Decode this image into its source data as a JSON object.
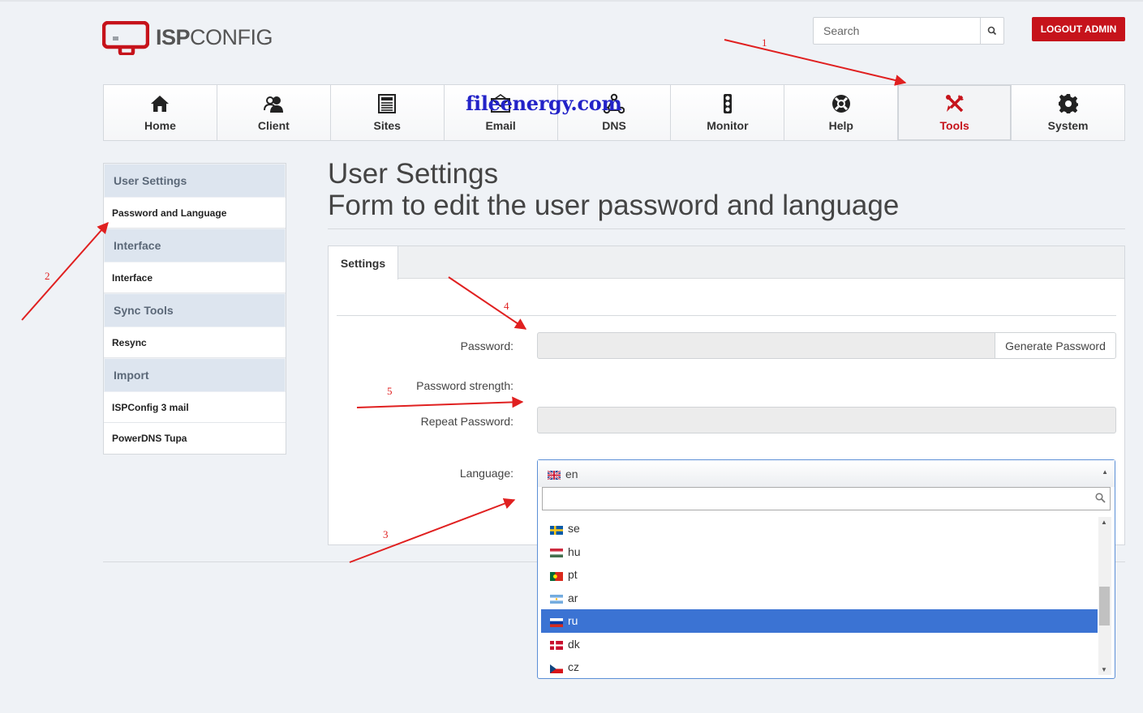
{
  "header": {
    "logo_text_bold": "ISP",
    "logo_text_light": "CONFIG",
    "search_placeholder": "Search",
    "logout_label": "LOGOUT ADMIN"
  },
  "nav": [
    {
      "label": "Home",
      "icon": "home-icon"
    },
    {
      "label": "Client",
      "icon": "users-icon"
    },
    {
      "label": "Sites",
      "icon": "sites-icon"
    },
    {
      "label": "Email",
      "icon": "envelope-icon"
    },
    {
      "label": "DNS",
      "icon": "dns-network-icon"
    },
    {
      "label": "Monitor",
      "icon": "traffic-light-icon"
    },
    {
      "label": "Help",
      "icon": "life-ring-icon"
    },
    {
      "label": "Tools",
      "icon": "tools-icon",
      "active": true
    },
    {
      "label": "System",
      "icon": "gear-icon"
    }
  ],
  "watermark": "fileenergy.com",
  "sidebar": {
    "sections": [
      {
        "title": "User Settings",
        "items": [
          "Password and Language"
        ]
      },
      {
        "title": "Interface",
        "items": [
          "Interface"
        ]
      },
      {
        "title": "Sync Tools",
        "items": [
          "Resync"
        ]
      },
      {
        "title": "Import",
        "items": [
          "ISPConfig 3 mail",
          "PowerDNS Tupa"
        ]
      }
    ]
  },
  "page": {
    "title_line1": "User Settings",
    "title_line2": "Form to edit the user password and language",
    "tab_label": "Settings"
  },
  "form": {
    "password_label": "Password:",
    "generate_button": "Generate Password",
    "strength_label": "Password strength:",
    "repeat_label": "Repeat Password:",
    "language_label": "Language:"
  },
  "language_select": {
    "selected": "en",
    "options": [
      {
        "code": "se",
        "flag": "sweden"
      },
      {
        "code": "hu",
        "flag": "hungary"
      },
      {
        "code": "pt",
        "flag": "portugal"
      },
      {
        "code": "ar",
        "flag": "argentina"
      },
      {
        "code": "ru",
        "flag": "russia",
        "highlighted": true
      },
      {
        "code": "dk",
        "flag": "denmark"
      },
      {
        "code": "cz",
        "flag": "czech"
      }
    ]
  },
  "annotations": [
    "1",
    "2",
    "3",
    "4",
    "5"
  ],
  "colors": {
    "brand_red": "#c6131b",
    "highlight_blue": "#3b73d3",
    "annotation_red": "#e02020",
    "watermark_blue": "#2323c8"
  }
}
